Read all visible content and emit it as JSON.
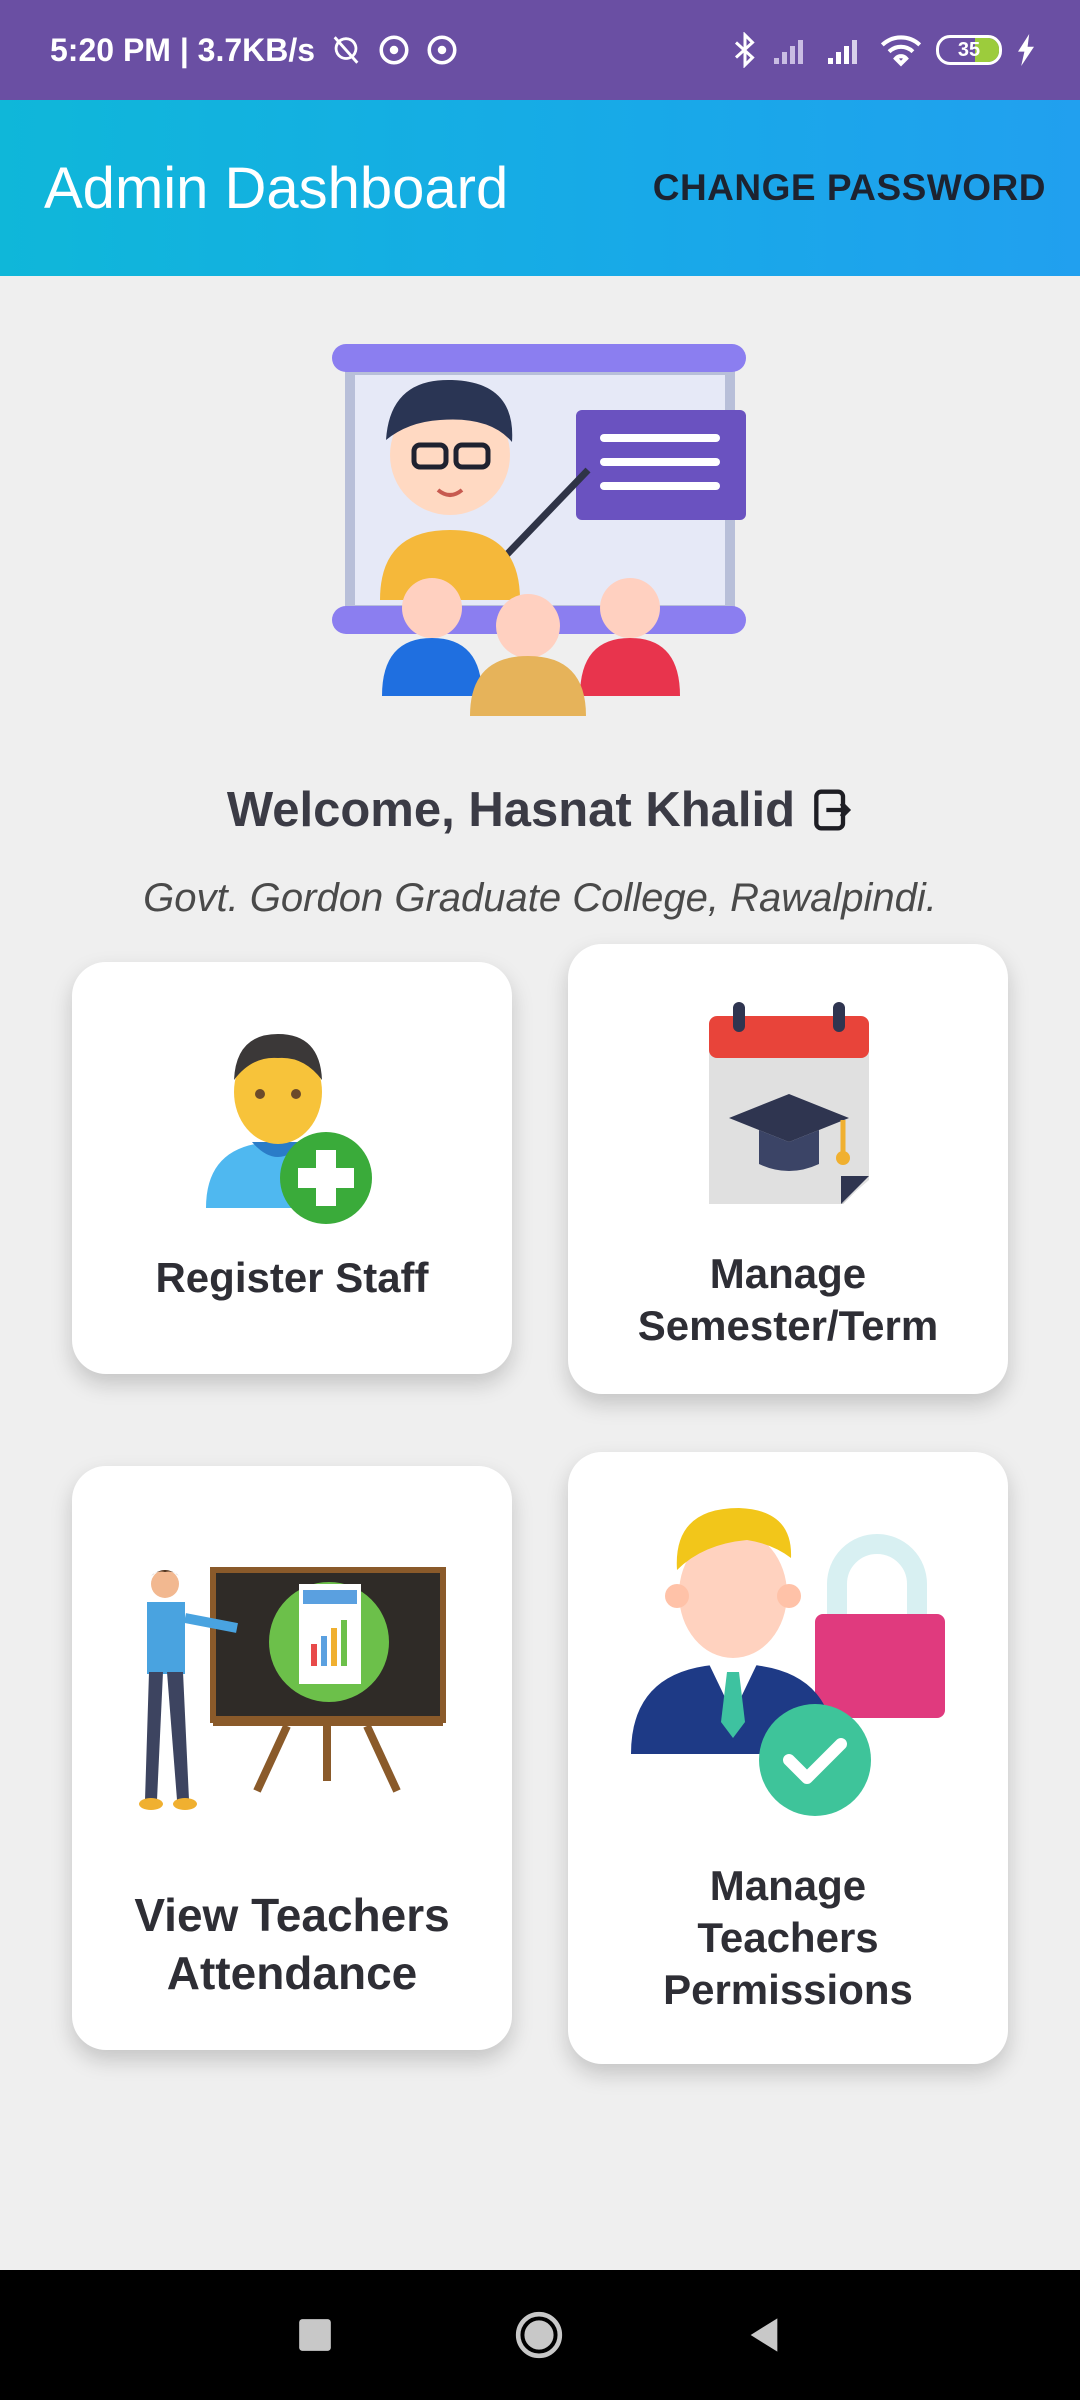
{
  "status_bar": {
    "time_speed": "5:20 PM | 3.7KB/s",
    "battery": "35"
  },
  "app_bar": {
    "title": "Admin Dashboard",
    "action_label": "CHANGE PASSWORD"
  },
  "welcome": {
    "text": "Welcome, Hasnat Khalid",
    "college": "Govt. Gordon Graduate College, Rawalpindi."
  },
  "cards": [
    {
      "label_lines": [
        "Register Staff"
      ],
      "icon": "add-person-icon"
    },
    {
      "label_lines": [
        "Manage",
        "Semester/Term"
      ],
      "icon": "calendar-graduation-icon"
    },
    {
      "label_lines": [
        "View Teachers",
        "Attendance"
      ],
      "icon": "teacher-report-icon"
    },
    {
      "label_lines": [
        "Manage",
        "Teachers",
        "Permissions"
      ],
      "icon": "permissions-icon"
    }
  ],
  "colors": {
    "status_bar": "#6a4fa3",
    "app_bar_start": "#0fb7d9",
    "app_bar_end": "#21a0ef",
    "background": "#efefef"
  }
}
